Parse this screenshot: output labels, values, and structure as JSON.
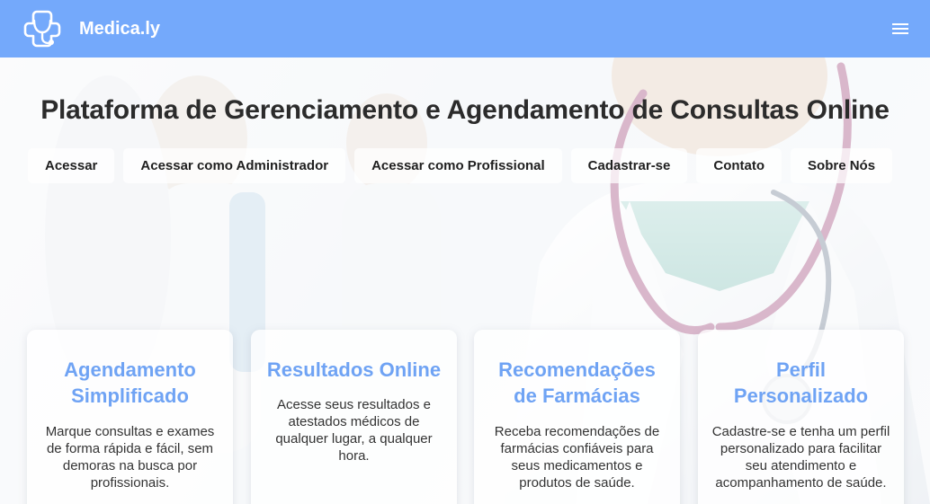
{
  "navbar": {
    "brand": "Medica.ly",
    "logo_icon": "medical-cross-stethoscope-icon",
    "menu_icon": "hamburger-menu-icon",
    "background": "#74a9fb"
  },
  "hero": {
    "title": "Plataforma de Gerenciamento e Agendamento de Consultas Online"
  },
  "nav_links": [
    "Acessar",
    "Acessar como Administrador",
    "Acessar como Profissional",
    "Cadastrar-se",
    "Contato",
    "Sobre Nós"
  ],
  "cards": [
    {
      "title_line1": "Agendamento",
      "title_line2": "Simplificado",
      "text": [
        "Marque consultas e exames",
        "de forma rápida e fácil, sem",
        "demoras na busca por",
        "profissionais."
      ]
    },
    {
      "title_line1": "Resultados Online",
      "title_line2": "",
      "text": [
        "Acesse seus resultados e",
        "atestados médicos de",
        "qualquer lugar, a qualquer",
        "hora."
      ]
    },
    {
      "title_line1": "Recomendações",
      "title_line2": "de Farmácias",
      "text": [
        "Receba recomendações de",
        "farmácias confiáveis para",
        "seus medicamentos e",
        "produtos de saúde."
      ]
    },
    {
      "title_line1": "Perfil",
      "title_line2": "Personalizado",
      "text": [
        "Cadastre-se e tenha um perfil",
        "personalizado para facilitar",
        "seu atendimento e",
        "acompanhamento de saúde."
      ]
    }
  ],
  "colors": {
    "accent": "#6fa3f4",
    "title": "#2b2b2b"
  }
}
